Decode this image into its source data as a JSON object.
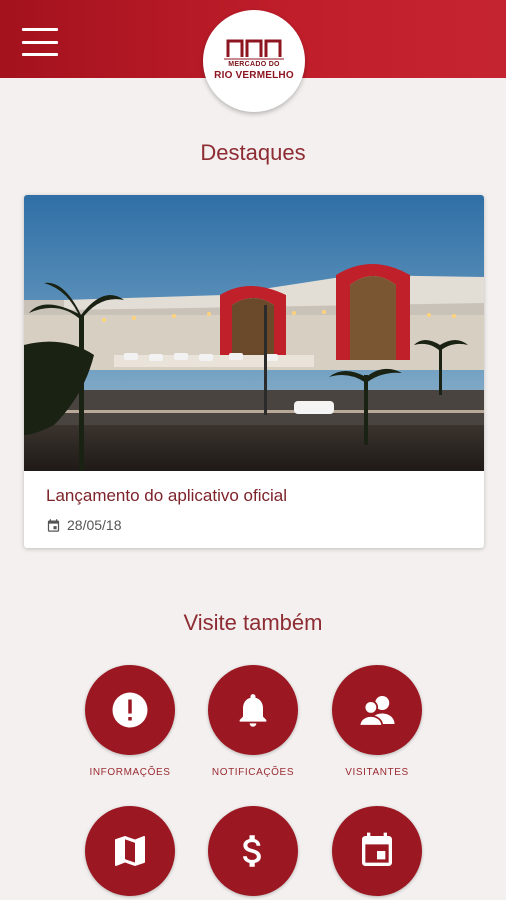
{
  "header": {
    "logo": {
      "line1": "MERCADO DO",
      "line2": "RIO VERMELHO"
    }
  },
  "highlights": {
    "title": "Destaques",
    "card": {
      "title": "Lançamento do aplicativo oficial",
      "date": "28/05/18"
    }
  },
  "visit": {
    "title": "Visite também",
    "items": [
      {
        "label": "INFORMAÇÕES",
        "icon": "info-icon"
      },
      {
        "label": "NOTIFICAÇÕES",
        "icon": "bell-icon"
      },
      {
        "label": "VISITANTES",
        "icon": "visitors-icon"
      },
      {
        "label": "",
        "icon": "map-icon"
      },
      {
        "label": "",
        "icon": "dollar-icon"
      },
      {
        "label": "",
        "icon": "calendar-icon"
      }
    ]
  },
  "colors": {
    "primary": "#b31a26",
    "accent": "#9b1822",
    "background": "#f3f0ef",
    "title": "#8e2c33"
  }
}
